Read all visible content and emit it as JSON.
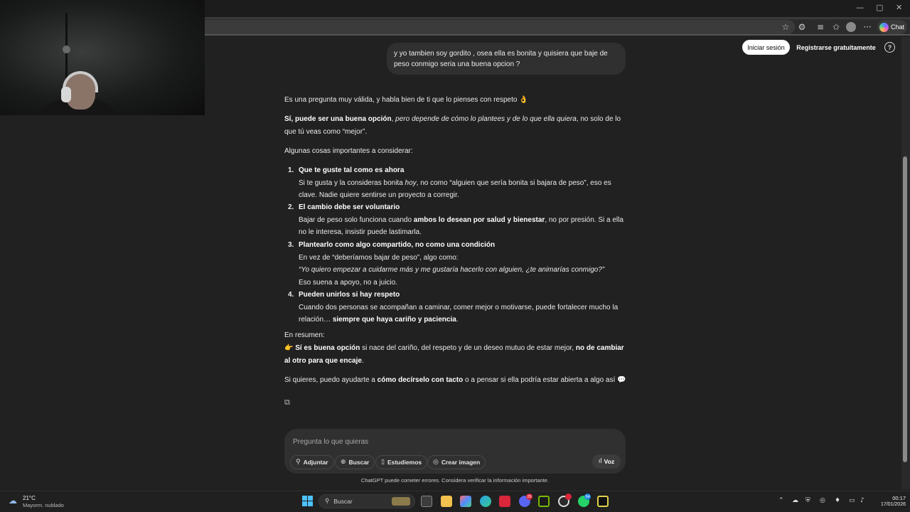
{
  "browser": {
    "chat_button_label": "Chat",
    "window_controls": [
      "—",
      "▢",
      "✕"
    ]
  },
  "header": {
    "login_label": "Iniciar sesión",
    "register_label": "Registrarse gratuitamente",
    "help_icon_glyph": "?"
  },
  "user_message": "y yo tambien soy gordito , osea ella es bonita y quisiera que baje de peso conmigo seria una buena opcion ?",
  "assistant": {
    "intro": "Es una pregunta muy válida, y habla bien de ti que lo pienses con respeto 👌",
    "p2_bold": "Sí, puede ser una buena opción",
    "p2_sep": ", ",
    "p2_italic": "pero depende de cómo lo plantees y de lo que ella quiera",
    "p2_rest": ", no solo de lo que tú veas como “mejor”.",
    "list_intro": "Algunas cosas importantes a considerar:",
    "items": [
      {
        "num": "1.",
        "title": "Que te guste tal como es ahora",
        "text_a": "Si te gusta y la consideras bonita ",
        "text_b_italic": "hoy",
        "text_c": ", no como “alguien que sería bonita si bajara de peso”, eso es clave. Nadie quiere sentirse un proyecto a corregir."
      },
      {
        "num": "2.",
        "title": "El cambio debe ser voluntario",
        "text_a": "Bajar de peso solo funciona cuando ",
        "text_b_bold": "ambos lo desean por salud y bienestar",
        "text_c": ", no por presión. Si a ella no le interesa, insistir puede lastimarla."
      },
      {
        "num": "3.",
        "title": "Plantearlo como algo compartido, no como una condición",
        "text_a": "En vez de “deberíamos bajar de peso”, algo como:",
        "quote": "“Yo quiero empezar a cuidarme más y me gustaría hacerlo con alguien, ¿te animarías conmigo?”",
        "text_c": "Eso suena a apoyo, no a juicio."
      },
      {
        "num": "4.",
        "title": "Pueden unirlos si hay respeto",
        "text_a": "Cuando dos personas se acompañan a caminar, comer mejor o motivarse, puede fortalecer mucho la relación… ",
        "text_b_bold": "siempre que haya cariño y paciencia",
        "text_c": "."
      }
    ],
    "summary_label": "En resumen:",
    "summary_emoji": "👉",
    "summary_bold1": "Sí es buena opción",
    "summary_mid": " si nace del cariño, del respeto y de un deseo mutuo de estar mejor, ",
    "summary_bold2": "no de cambiar al otro para que encaje",
    "summary_end": ".",
    "closing_a": "Si quieres, puedo ayudarte a ",
    "closing_bold": "cómo decírselo con tacto",
    "closing_c": " o a pensar si ella podría estar abierta a algo así 💬"
  },
  "composer": {
    "placeholder": "Pregunta lo que quieras",
    "attach_label": "Adjuntar",
    "search_label": "Buscar",
    "study_label": "Estudiemos",
    "image_label": "Crear imagen",
    "voice_label": "Voz"
  },
  "disclaimer": "ChatGPT puede cometer errores. Considera verificar la información importante.",
  "taskbar": {
    "temperature": "21°C",
    "weather_desc": "Mayorm. nublado",
    "search_placeholder": "Buscar",
    "time": "00:17",
    "date": "17/01/2026",
    "badge_discord": "29",
    "badge_whatsapp": "54"
  },
  "colors": {
    "background": "#212121",
    "bubble": "#303030",
    "accent_start": "#4cc2ff"
  }
}
